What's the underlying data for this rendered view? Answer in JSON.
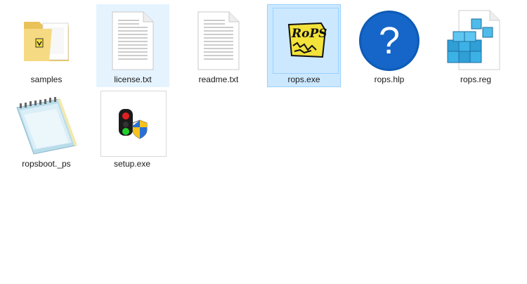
{
  "files": [
    {
      "label": "samples",
      "icon": "folder-icon",
      "state": "normal"
    },
    {
      "label": "license.txt",
      "icon": "text-document-icon",
      "state": "hover"
    },
    {
      "label": "readme.txt",
      "icon": "text-document-icon",
      "state": "normal"
    },
    {
      "label": "rops.exe",
      "icon": "rops-app-icon",
      "state": "selected"
    },
    {
      "label": "rops.hlp",
      "icon": "help-file-icon",
      "state": "normal"
    },
    {
      "label": "rops.reg",
      "icon": "registry-file-icon",
      "state": "normal"
    },
    {
      "label": "ropsboot._ps",
      "icon": "notepad-icon",
      "state": "normal"
    },
    {
      "label": "setup.exe",
      "icon": "installer-icon",
      "state": "normal"
    }
  ],
  "rops_icon_text": "RoPS",
  "help_icon_glyph": "?",
  "colors": {
    "hover_bg": "#e5f3ff",
    "selected_bg": "#cce8ff",
    "selected_border": "#99d1ff",
    "folder": "#f4d77a",
    "help_blue": "#1565c0"
  }
}
